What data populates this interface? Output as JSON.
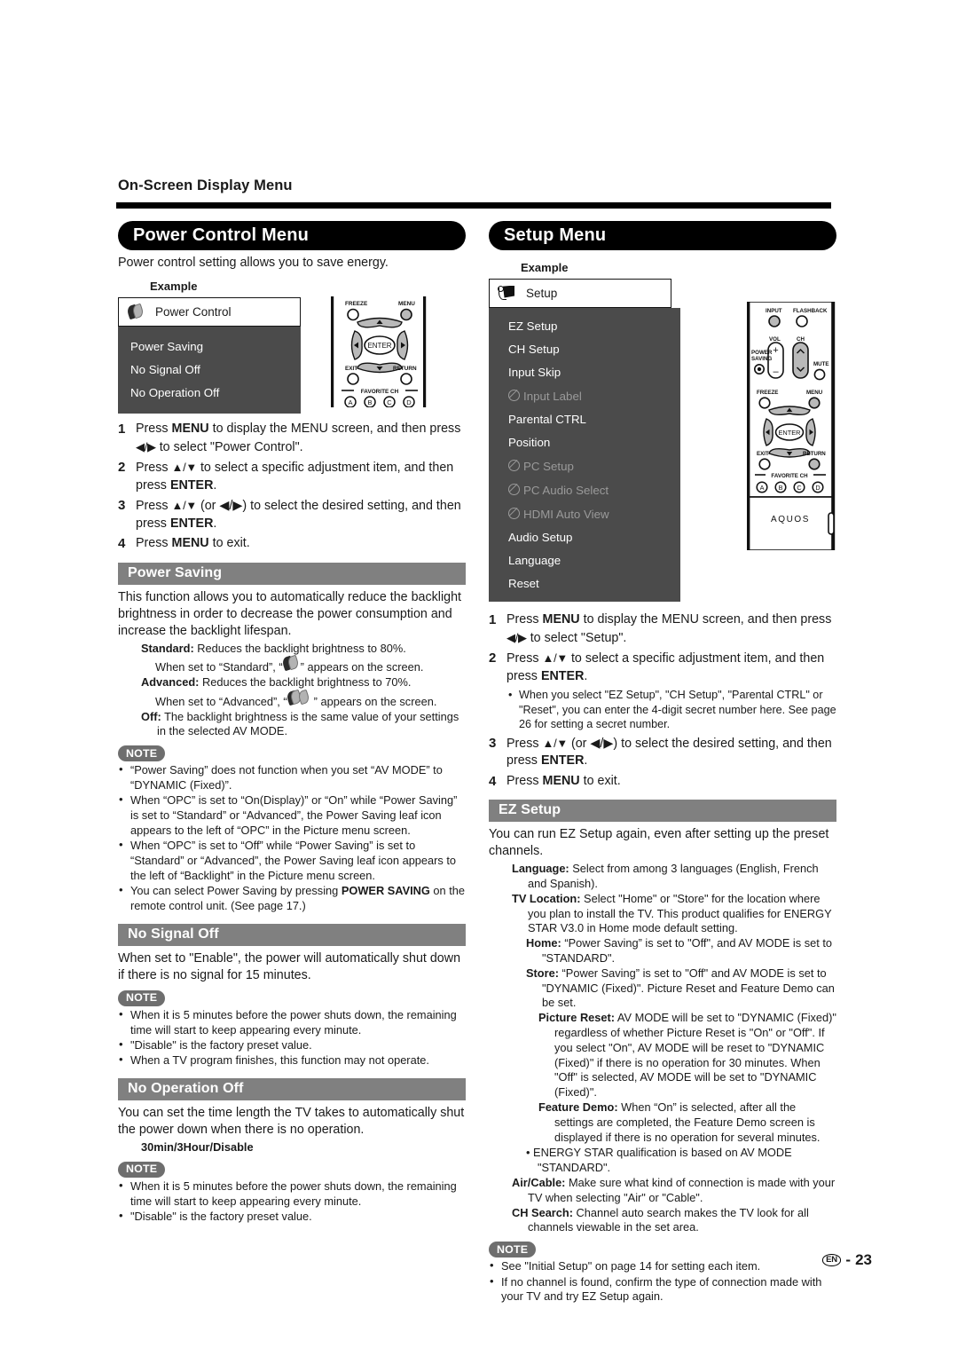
{
  "running_head": "On-Screen Display Menu",
  "page_footer": {
    "locale_badge": "EN",
    "separator": "-",
    "page_number": "23"
  },
  "left": {
    "title": "Power Control Menu",
    "lead": "Power control setting allows you to save energy.",
    "example_label": "Example",
    "osd": {
      "tab_label": "Power Control",
      "tab_icon": "leaf-icon",
      "items": [
        {
          "label": "Power Saving",
          "disabled": false
        },
        {
          "label": "No Signal Off",
          "disabled": false
        },
        {
          "label": "No Operation Off",
          "disabled": false
        }
      ]
    },
    "steps": [
      {
        "n": "1",
        "pre": "Press ",
        "b1": "MENU",
        "mid": " to display the MENU screen, and then press ",
        "arrows": "◀/▶",
        "post": " to select \"Power Control\"."
      },
      {
        "n": "2",
        "pre": "Press ",
        "arrows": "▲/▼",
        "mid": " to select a specific adjustment item, and then press ",
        "b1": "ENTER",
        "post": "."
      },
      {
        "n": "3",
        "pre": "Press ",
        "arrows": "▲/▼",
        "mid": " (or ◀/▶) to select the desired setting, and then press ",
        "b1": "ENTER",
        "post": "."
      },
      {
        "n": "4",
        "pre": "Press ",
        "b1": "MENU",
        "post": " to exit."
      }
    ],
    "power_saving": {
      "heading": "Power Saving",
      "body": "This function allows you to automatically reduce the backlight brightness in order to decrease the power consumption and increase the backlight lifespan.",
      "defs": [
        {
          "term": "Standard:",
          "text": " Reduces the backlight brightness to 80%."
        },
        {
          "term": "",
          "text": "When set to “Standard”, “” appears on the screen.",
          "icon": "leaf-single",
          "indent": 1
        },
        {
          "term": "Advanced:",
          "text": " Reduces the backlight brightness to 70%."
        },
        {
          "term": "",
          "text": "When set to “Advanced”, “” appears on the screen.",
          "icon": "leaf-double",
          "indent": 1
        },
        {
          "term": "Off:",
          "text": " The backlight brightness is the same value of your settings in the selected AV MODE."
        }
      ],
      "note_label": "NOTE",
      "notes": [
        "“Power Saving” does not function when you set “AV MODE” to “DYNAMIC (Fixed)”.",
        "When “OPC” is set to “On(Display)” or “On” while “Power Saving” is set to “Standard” or “Advanced”, the Power Saving leaf icon appears to the left of “OPC” in the Picture menu screen.",
        "When “OPC” is set to “Off” while “Power Saving” is set to “Standard” or “Advanced”, the Power Saving leaf icon appears to the left of “Backlight” in the Picture menu screen."
      ],
      "note_last_pre": "You can select Power Saving by pressing ",
      "note_last_bold": "POWER SAVING",
      "note_last_post": " on the remote control unit. (See page 17.)"
    },
    "no_signal_off": {
      "heading": "No Signal Off",
      "body": "When set to \"Enable\", the power will automatically shut down if there is no signal for 15 minutes.",
      "note_label": "NOTE",
      "notes": [
        "When it is 5 minutes before the power shuts down, the remaining time will start to keep appearing every minute.",
        "\"Disable\" is the factory preset value.",
        "When a TV program finishes, this function may not operate."
      ]
    },
    "no_operation_off": {
      "heading": "No Operation Off",
      "body": "You can set the time length the TV takes to automatically shut the power down when there is no operation.",
      "options": "30min/3Hour/Disable",
      "note_label": "NOTE",
      "notes": [
        "When it is 5 minutes before the power shuts down, the remaining time will start to keep appearing every minute.",
        "\"Disable\" is the factory preset value."
      ]
    }
  },
  "right": {
    "title": "Setup Menu",
    "example_label": "Example",
    "osd": {
      "tab_label": "Setup",
      "tab_icon": "setup-icon",
      "items": [
        {
          "label": "EZ Setup",
          "disabled": false
        },
        {
          "label": "CH Setup",
          "disabled": false
        },
        {
          "label": "Input Skip",
          "disabled": false
        },
        {
          "label": "Input Label",
          "disabled": true
        },
        {
          "label": "Parental CTRL",
          "disabled": false
        },
        {
          "label": "Position",
          "disabled": false
        },
        {
          "label": "PC Setup",
          "disabled": true
        },
        {
          "label": "PC Audio Select",
          "disabled": true
        },
        {
          "label": "HDMI Auto View",
          "disabled": true
        },
        {
          "label": "Audio Setup",
          "disabled": false
        },
        {
          "label": "Language",
          "disabled": false
        },
        {
          "label": "Reset",
          "disabled": false
        }
      ]
    },
    "steps": [
      {
        "n": "1",
        "pre": "Press ",
        "b1": "MENU",
        "mid": " to display the MENU screen, and then press ",
        "arrows": "◀/▶",
        "post": " to select \"Setup\"."
      },
      {
        "n": "2",
        "pre": "Press ",
        "arrows": "▲/▼",
        "mid": " to select a specific adjustment item, and then press ",
        "b1": "ENTER",
        "post": "."
      },
      {
        "n": "3",
        "pre": "Press ",
        "arrows": "▲/▼",
        "mid": " (or ◀/▶) to select the desired setting, and then press ",
        "b1": "ENTER",
        "post": "."
      },
      {
        "n": "4",
        "pre": "Press ",
        "b1": "MENU",
        "post": " to exit."
      }
    ],
    "step2_substep": "When you select \"EZ Setup\", \"CH Setup\", \"Parental CTRL\" or \"Reset\", you can enter the 4-digit secret number here. See page 26 for setting a secret number.",
    "ez_setup": {
      "heading": "EZ Setup",
      "body": "You can run EZ Setup again, even after setting up the preset channels.",
      "defs": [
        {
          "term": "Language:",
          "text": " Select from among 3 languages (English, French and Spanish).",
          "indent": 1
        },
        {
          "term": "TV Location:",
          "text": " Select \"Home\" or \"Store\" for the location where you plan to install the TV. This product qualifies for ENERGY STAR V3.0 in Home mode default setting.",
          "indent": 1
        },
        {
          "term": "Home:",
          "text": " “Power Saving” is set to \"Off\", and AV MODE is set to \"STANDARD\".",
          "indent": 2
        },
        {
          "term": "Store:",
          "text": " “Power Saving” is set to \"Off\" and AV MODE is set to \"DYNAMIC (Fixed)\". Picture Reset and Feature Demo can be set.",
          "indent": 2
        },
        {
          "term": "Picture Reset:",
          "text": " AV MODE will be set to \"DYNAMIC (Fixed)\" regardless of whether Picture Reset is \"On\" or \"Off\". If you select \"On\", AV MODE will be reset to \"DYNAMIC (Fixed)\" if there is no operation for 30 minutes. When \"Off\" is selected, AV MODE will be set to \"DYNAMIC (Fixed)\".",
          "indent": 3
        },
        {
          "term": "Feature Demo:",
          "text": " When “On” is selected, after all the settings are completed, the Feature Demo screen is displayed if there is no operation for several minutes.",
          "indent": 3
        }
      ],
      "energy_star_bullet": "ENERGY STAR qualification is based on AV MODE \"STANDARD\".",
      "defs_tail": [
        {
          "term": "Air/Cable:",
          "text": " Make sure what kind of connection is made with your TV when selecting \"Air\" or \"Cable\".",
          "indent": 1
        },
        {
          "term": "CH Search:",
          "text": " Channel auto search makes the TV look for all channels viewable in the set area.",
          "indent": 1
        }
      ],
      "note_label": "NOTE",
      "notes": [
        "See \"Initial Setup\" on page 14 for setting each item.",
        "If no channel is found, confirm the type of connection made with your TV and try EZ Setup again."
      ]
    }
  },
  "remote_left": {
    "labels": {
      "freeze": "FREEZE",
      "menu": "MENU",
      "enter": "ENTER",
      "exit": "EXIT",
      "return": "RETURN",
      "favorite": "FAVORITE CH",
      "a": "A",
      "b": "B",
      "c": "C",
      "d": "D"
    }
  },
  "remote_right": {
    "labels": {
      "input": "INPUT",
      "flashback": "FLASHBACK",
      "vol": "VOL",
      "ch": "CH",
      "power_saving": "POWER SAVING",
      "mute": "MUTE",
      "freeze": "FREEZE",
      "menu": "MENU",
      "enter": "ENTER",
      "exit": "EXIT",
      "return": "RETURN",
      "favorite": "FAVORITE CH",
      "a": "A",
      "b": "B",
      "c": "C",
      "d": "D",
      "brand": "AQUOS"
    }
  },
  "colors": {
    "bar_gray": "#808080",
    "osd_gray": "#4b4b4b",
    "note_gray": "#6e6e6e",
    "black": "#000000"
  }
}
